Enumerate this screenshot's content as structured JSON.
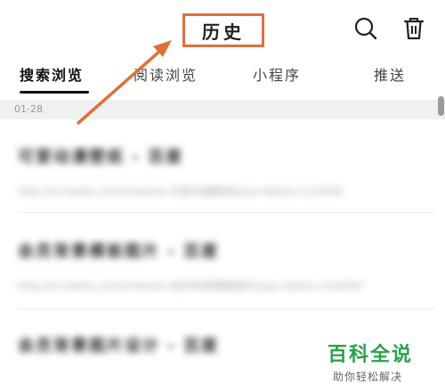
{
  "header": {
    "title": "历史",
    "search_icon": "search-icon",
    "trash_icon": "trash-icon",
    "highlight_color": "#e0703a"
  },
  "tabs": [
    {
      "label": "搜索浏览",
      "active": true
    },
    {
      "label": "阅读浏览",
      "active": false
    },
    {
      "label": "小程序",
      "active": false
    },
    {
      "label": "推送",
      "active": false
    }
  ],
  "date_header": "01-28",
  "history": [
    {
      "title": "可爱动漫壁纸 - 百度",
      "url": "http://m.baidu.com/s?word=可爱动漫壁纸&sa=tb&ts=123456"
    },
    {
      "title": "会员背景模板图片 - 百度",
      "url": "http://m.baidu.com/s?word=会员背景模板图片&sa=tb&ts=234567"
    },
    {
      "title": "会员背景图片设计 - 百度",
      "url": ""
    }
  ],
  "watermark": {
    "title": "百科全说",
    "subtitle": "助你轻松解决"
  }
}
